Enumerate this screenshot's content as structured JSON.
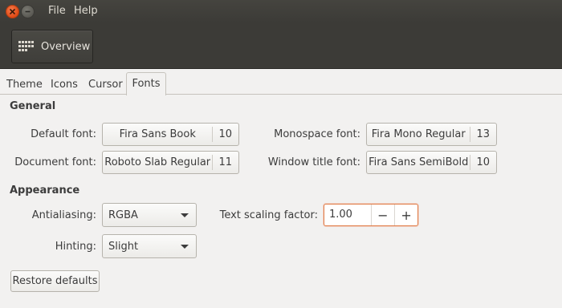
{
  "window": {
    "menu": [
      "File",
      "Help"
    ]
  },
  "header": {
    "overview_label": "Overview"
  },
  "tabs": [
    {
      "label": "Theme",
      "active": false
    },
    {
      "label": "Icons",
      "active": false
    },
    {
      "label": "Cursor",
      "active": false
    },
    {
      "label": "Fonts",
      "active": true
    }
  ],
  "general": {
    "title": "General",
    "default_font": {
      "label": "Default font:",
      "name": "Fira Sans Book",
      "size": "10"
    },
    "document_font": {
      "label": "Document font:",
      "name": "Roboto Slab Regular",
      "size": "11"
    },
    "monospace_font": {
      "label": "Monospace font:",
      "name": "Fira Mono Regular",
      "size": "13"
    },
    "window_title_font": {
      "label": "Window title font:",
      "name": "Fira Sans SemiBold",
      "size": "10"
    }
  },
  "appearance": {
    "title": "Appearance",
    "antialiasing": {
      "label": "Antialiasing:",
      "value": "RGBA"
    },
    "hinting": {
      "label": "Hinting:",
      "value": "Slight"
    },
    "scaling": {
      "label": "Text scaling factor:",
      "value": "1.00",
      "minus": "−",
      "plus": "+"
    }
  },
  "restore_label": "Restore defaults",
  "colors": {
    "accent": "#e95420",
    "header": "#3c3b37",
    "background": "#f2f1f0"
  }
}
